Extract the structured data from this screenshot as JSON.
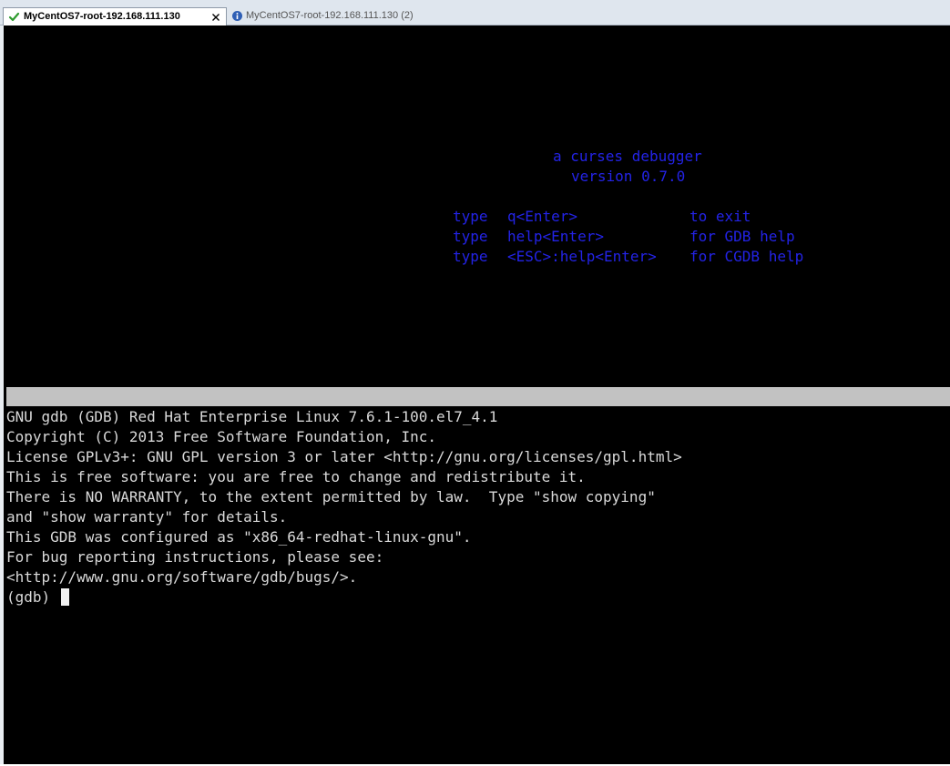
{
  "tabs": [
    {
      "label": "MyCentOS7-root-192.168.111.130",
      "status_icon": "check-icon",
      "active": true,
      "close_symbol": "x"
    },
    {
      "label": "MyCentOS7-root-192.168.111.130 (2)",
      "status_icon": "info-icon",
      "active": false
    }
  ],
  "splash": {
    "title": "a curses debugger",
    "version": "version 0.7.0",
    "help_rows": [
      {
        "type": "type",
        "command": "q<Enter>",
        "desc": "to exit"
      },
      {
        "type": "type",
        "command": "help<Enter>",
        "desc": "for GDB help"
      },
      {
        "type": "type",
        "command": "<ESC>:help<Enter>",
        "desc": "for CGDB help"
      }
    ]
  },
  "gdb_output": [
    "GNU gdb (GDB) Red Hat Enterprise Linux 7.6.1-100.el7_4.1",
    "Copyright (C) 2013 Free Software Foundation, Inc.",
    "License GPLv3+: GNU GPL version 3 or later <http://gnu.org/licenses/gpl.html>",
    "This is free software: you are free to change and redistribute it.",
    "There is NO WARRANTY, to the extent permitted by law.  Type \"show copying\"",
    "and \"show warranty\" for details.",
    "This GDB was configured as \"x86_64-redhat-linux-gnu\".",
    "For bug reporting instructions, please see:",
    "<http://www.gnu.org/software/gdb/bugs/>."
  ],
  "prompt": "(gdb)",
  "colors": {
    "terminal_bg": "#000000",
    "splash_text": "#2323e6",
    "output_text": "#d9d9d9",
    "status_bar": "#c2c2c2",
    "check_icon": "#2e9b2e",
    "info_icon": "#2f5fb5"
  }
}
